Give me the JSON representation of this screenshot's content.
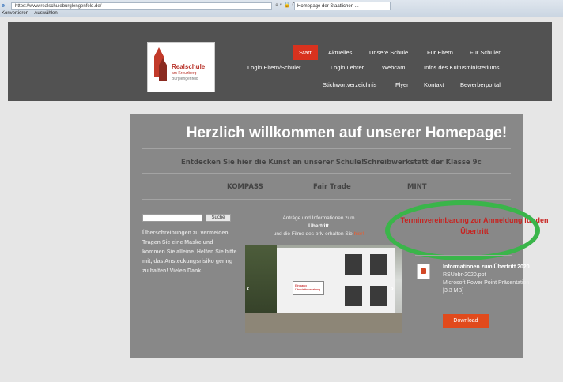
{
  "browser": {
    "url": "https://www.realschuleburglengenfeld.de/",
    "tab_title": "Homepage der Staatlichen ...",
    "fav_items": [
      "Konvertieren",
      "Auswählen"
    ],
    "nav_buttons": "⌕ ▾ 🔒 C"
  },
  "logo": {
    "line1": "Realschule",
    "line2": "am Kreuzberg",
    "line3": "Burglengenfeld"
  },
  "nav": {
    "row1": [
      "Start",
      "Aktuelles",
      "Unsere Schule",
      "Für Eltern",
      "Für Schüler"
    ],
    "row2": [
      "Login Eltern/Schüler",
      "Login Lehrer",
      "Webcam",
      "Infos des Kultusministeriums"
    ],
    "row3": [
      "Stichwortverzeichnis",
      "Flyer",
      "Kontakt",
      "Bewerberportal"
    ]
  },
  "main": {
    "welcome": "Herzlich willkommen auf unserer Homepage!",
    "links1": [
      "Entdecken Sie hier die Kunst an unserer Schule!",
      "Schreibwerkstatt der Klasse 9c"
    ],
    "links2": [
      "KOMPASS",
      "Fair Trade",
      "MINT"
    ],
    "search_button": "Suche",
    "left_text": "Überschreibungen zu vermeiden. Tragen Sie eine Maske und kommen Sie alleine. Helfen Sie bitte mit, das Ansteckungsrisiko gering zu halten! Vielen Dank.",
    "center": {
      "line1": "Anträge und Informationen zum",
      "line2": "Übertritt",
      "line3": "und die Filme des brlv erhalten Sie",
      "line3_link": "hier!"
    },
    "photo_sign": "Eingang Übertrittsberatung",
    "termin": "Terminvereinbarung zur Anmeldung für den Übertritt",
    "info": {
      "title": "Informationen zum Übertritt 2020",
      "file": "RSUebr-2020.ppt",
      "type": "Microsoft Power Point Präsentation [3.3 MB]"
    },
    "download": "Download"
  }
}
